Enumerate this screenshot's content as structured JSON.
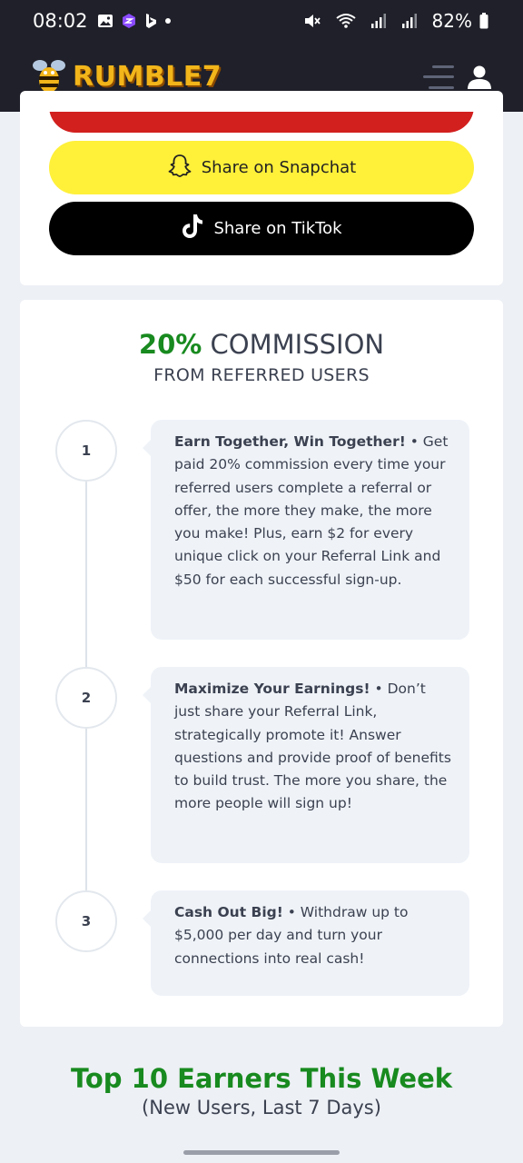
{
  "status_bar": {
    "time": "08:02",
    "battery": "82%",
    "icons": [
      "gallery-icon",
      "app-icon",
      "bing-icon",
      "dot-icon",
      "mute-icon",
      "wifi-icon",
      "signal-icon",
      "signal-icon",
      "battery-icon"
    ]
  },
  "header": {
    "logo_text": "RUMBLE7",
    "icons": [
      "bee-logo-icon",
      "menu-icon",
      "user-icon"
    ]
  },
  "share": {
    "snapchat_label": "Share on Snapchat",
    "tiktok_label": "Share on TikTok",
    "colors": {
      "snapchat": "#fff03a",
      "tiktok": "#000000",
      "red_button": "#d2201f"
    }
  },
  "commission": {
    "percent": "20%",
    "title_rest": "COMMISSION",
    "subtitle": "FROM REFERRED USERS",
    "steps": [
      {
        "number": "1",
        "heading": "Earn Together, Win Together!",
        "text": " • Get paid 20% commission every time your referred users complete a referral or offer, the more they make, the more you make! Plus, earn $2 for every unique click on your Referral Link and $50 for each successful sign-up."
      },
      {
        "number": "2",
        "heading": "Maximize Your Earnings!",
        "text": " • Don’t just share your Referral Link, strategically promote it! Answer questions and provide proof of benefits to build trust. The more you share, the more people will sign up!"
      },
      {
        "number": "3",
        "heading": "Cash Out Big!",
        "text": " • Withdraw up to $5,000 per day and turn your connections into real cash!"
      }
    ]
  },
  "top_earners": {
    "title": "Top 10 Earners This Week",
    "subtitle": "(New Users, Last 7 Days)"
  },
  "colors": {
    "accent_green": "#188a1f",
    "header_bg": "#1f2029",
    "logo_yellow": "#f2b51a"
  }
}
